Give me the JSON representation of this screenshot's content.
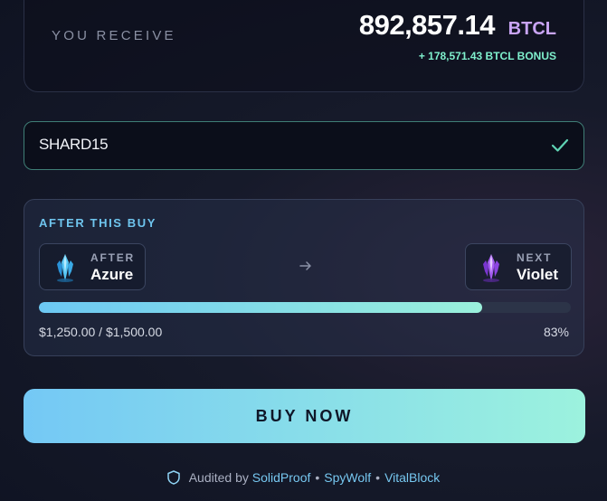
{
  "receive": {
    "label": "YOU RECEIVE",
    "amount": "892,857.14",
    "token": "BTCL",
    "bonus": "+ 178,571.43 BTCL BONUS"
  },
  "code_field": {
    "value": "SHARD15",
    "valid_icon": "check-icon"
  },
  "tier": {
    "title": "AFTER THIS BUY",
    "current": {
      "label": "AFTER",
      "name": "Azure",
      "icon": "azure-crystal-icon"
    },
    "next": {
      "label": "NEXT",
      "name": "Violet",
      "icon": "violet-crystal-icon"
    },
    "arrow_icon": "arrow-right-icon",
    "progress_text": "$1,250.00 / $1,500.00",
    "progress_percent_text": "83%",
    "progress_fraction": 0.833
  },
  "buy_button": {
    "label": "BUY NOW"
  },
  "audit": {
    "prefix": "Audited by",
    "auditors": [
      "SolidProof",
      "SpyWolf",
      "VitalBlock"
    ],
    "separator": "•",
    "icon": "shield-icon"
  },
  "colors": {
    "accent_blue": "#6fc5ee",
    "accent_mint": "#9af0db",
    "bonus_green": "#7ff0cd",
    "token_purple": "#c9a4f5"
  }
}
